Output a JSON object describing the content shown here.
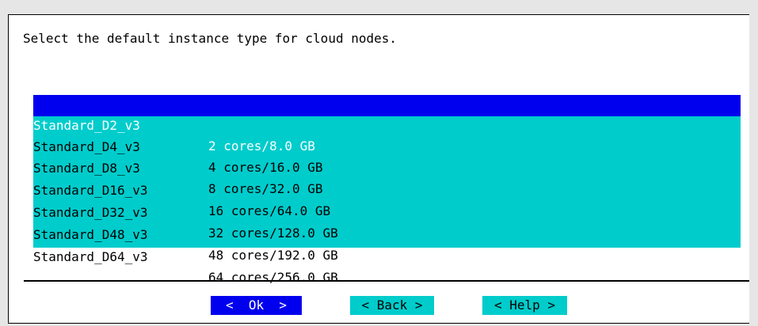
{
  "dialog": {
    "prompt": "Select the default instance type for cloud nodes.",
    "selected_index": 0,
    "options": [
      {
        "name": "Standard_D2_v3",
        "description": "2 cores/8.0 GB"
      },
      {
        "name": "Standard_D4_v3",
        "description": "4 cores/16.0 GB"
      },
      {
        "name": "Standard_D8_v3",
        "description": "8 cores/32.0 GB"
      },
      {
        "name": "Standard_D16_v3",
        "description": "16 cores/64.0 GB"
      },
      {
        "name": "Standard_D32_v3",
        "description": "32 cores/128.0 GB"
      },
      {
        "name": "Standard_D48_v3",
        "description": "48 cores/192.0 GB"
      },
      {
        "name": "Standard_D64_v3",
        "description": "64 cores/256.0 GB"
      }
    ],
    "buttons": {
      "ok": "<  Ok  >",
      "back": "< Back >",
      "help": "< Help >"
    }
  },
  "colors": {
    "selection": "#0000ee",
    "menu_background": "#00cccc",
    "dialog_background": "#ffffff",
    "screen_background": "#e6e6e6"
  }
}
